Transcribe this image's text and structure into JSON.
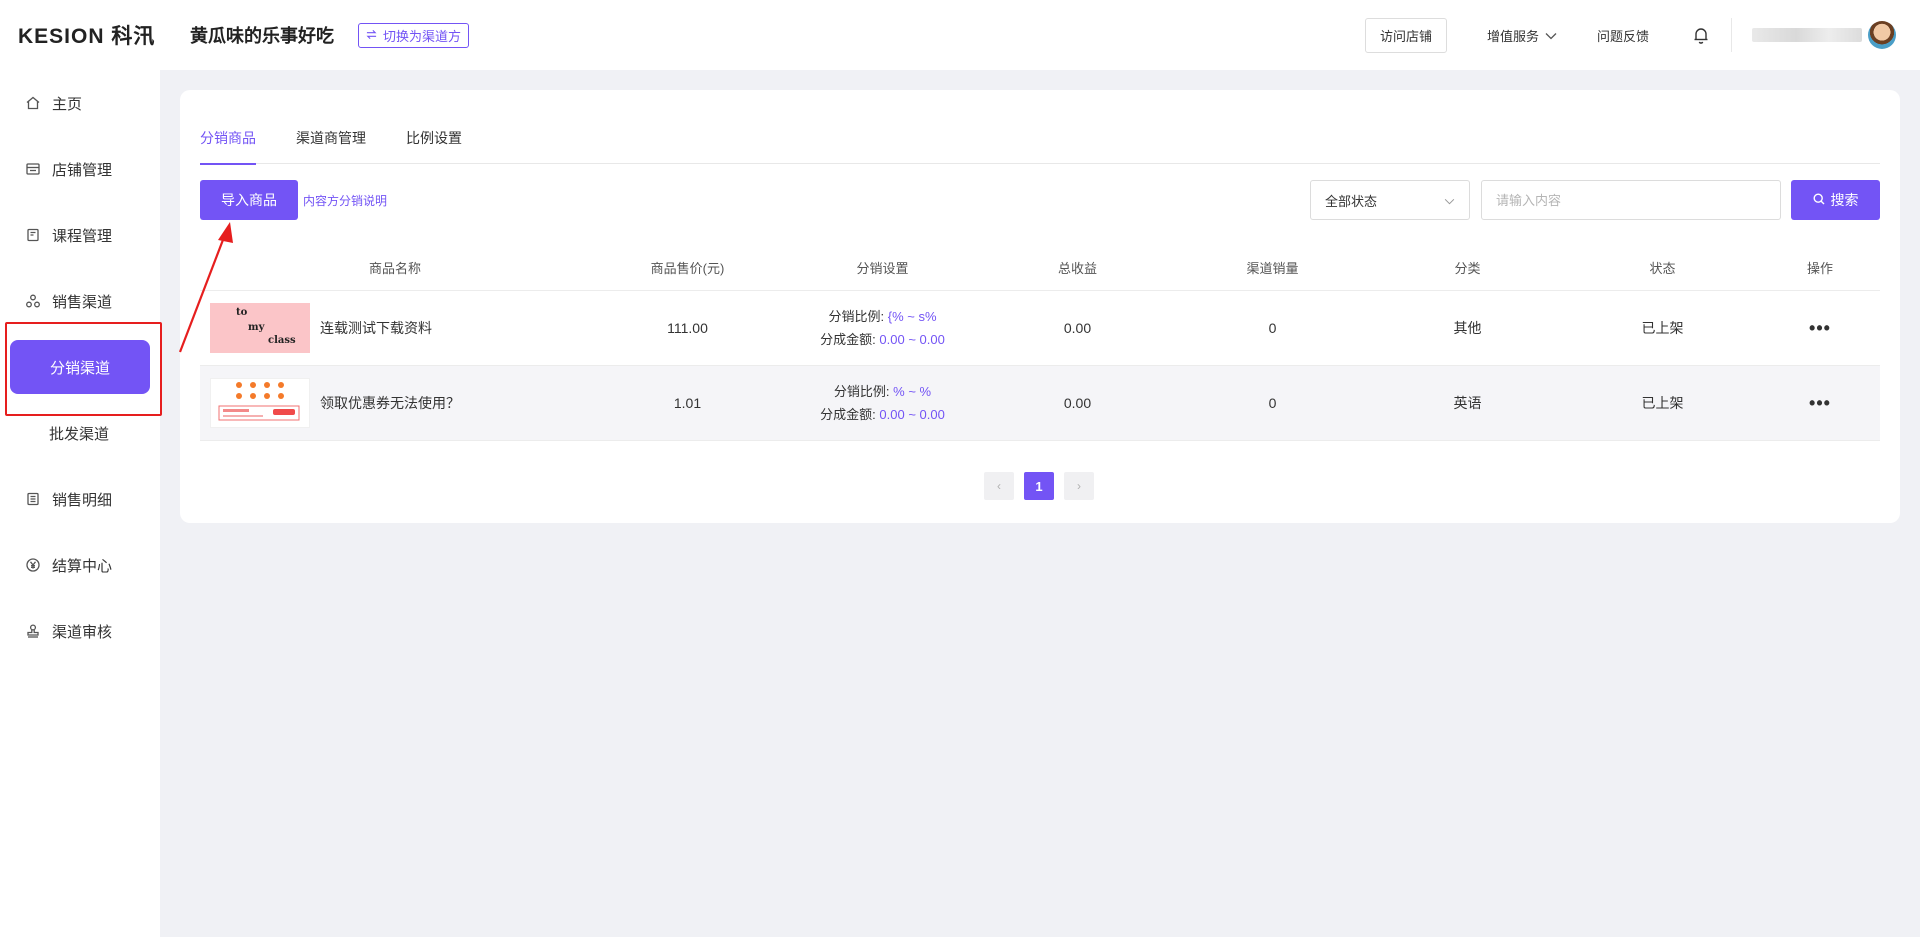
{
  "brand": {
    "logo_text": "KESION 科汛"
  },
  "sidebar": {
    "items": [
      {
        "label": "主页",
        "icon": "home-icon"
      },
      {
        "label": "店铺管理",
        "icon": "store-icon"
      },
      {
        "label": "课程管理",
        "icon": "course-icon"
      },
      {
        "label": "销售渠道",
        "icon": "channel-icon"
      },
      {
        "label": "分销渠道",
        "active": true
      },
      {
        "label": "批发渠道"
      },
      {
        "label": "销售明细",
        "icon": "list-icon"
      },
      {
        "label": "结算中心",
        "icon": "yen-icon"
      },
      {
        "label": "渠道审核",
        "icon": "stamp-icon"
      }
    ]
  },
  "header": {
    "shop_name": "黄瓜味的乐事好吃",
    "switch_label": "切换为渠道方",
    "visit_store": "访问店铺",
    "value_services": "增值服务",
    "feedback": "问题反馈"
  },
  "tabs": [
    {
      "label": "分销商品",
      "active": true
    },
    {
      "label": "渠道商管理"
    },
    {
      "label": "比例设置"
    }
  ],
  "toolbar": {
    "import_label": "导入商品",
    "explain_link": "内容方分销说明",
    "status_selected": "全部状态",
    "search_placeholder": "请输入内容",
    "search_label": "搜索"
  },
  "table": {
    "headers": [
      "商品名称",
      "商品售价(元)",
      "分销设置",
      "总收益",
      "渠道销量",
      "分类",
      "状态",
      "操作"
    ],
    "rows": [
      {
        "name": "连载测试下载资料",
        "thumb_text": [
          "to",
          "my",
          "class"
        ],
        "price": "111.00",
        "ratio_label": "分销比例:",
        "ratio_value": "{% ~ s%",
        "amount_label": "分成金额:",
        "amount_value": "0.00 ~ 0.00",
        "income": "0.00",
        "sales": "0",
        "category": "其他",
        "status": "已上架",
        "ops": "•••"
      },
      {
        "name": "领取优惠券无法使用？",
        "price": "1.01",
        "ratio_label": "分销比例:",
        "ratio_value": "% ~ %",
        "amount_label": "分成金额:",
        "amount_value": "0.00 ~ 0.00",
        "income": "0.00",
        "sales": "0",
        "category": "英语",
        "status": "已上架",
        "ops": "•••"
      }
    ]
  },
  "pagination": {
    "prev": "‹",
    "current": "1",
    "next": "›"
  },
  "colors": {
    "accent": "#7354f5",
    "highlight": "#e61e1e"
  }
}
